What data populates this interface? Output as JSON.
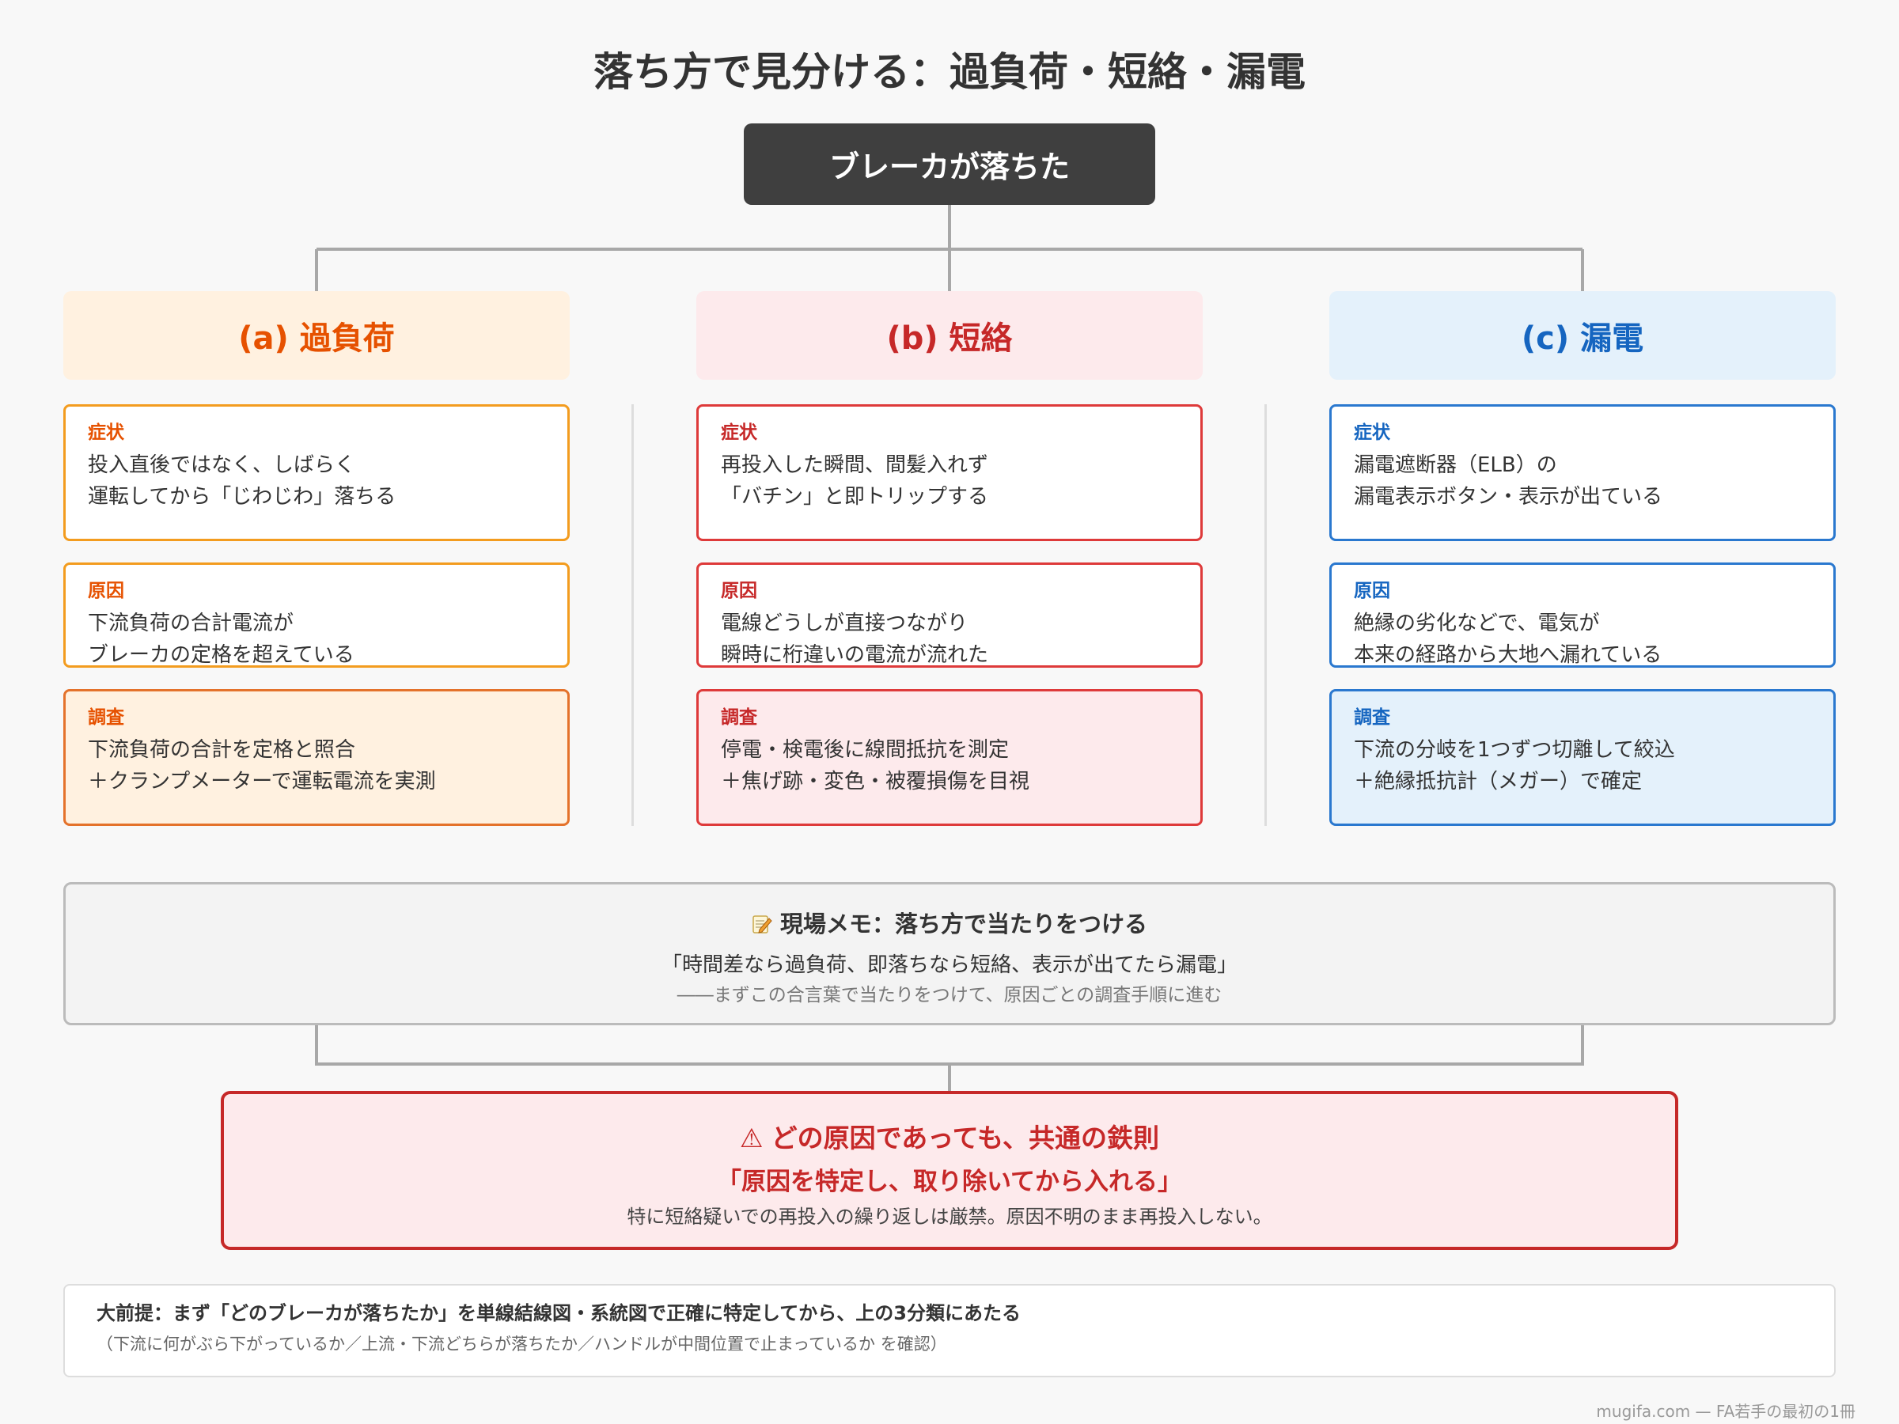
{
  "title": "落ち方で見分ける：過負荷・短絡・漏電",
  "root": "ブレーカが落ちた",
  "colors": {
    "overload": "#e65100",
    "overload_border": "#f39c1f",
    "overload_light": "#fff1e0",
    "overload_survey_border": "#e4722b",
    "short": "#c62828",
    "short_border": "#de3a3a",
    "short_light": "#fdeaec",
    "leak": "#1565c0",
    "leak_border": "#2a78cf",
    "leak_light": "#e4f1fb"
  },
  "columns": [
    {
      "header": "(a) 過負荷",
      "cards": [
        {
          "label": "症状",
          "text": "投入直後ではなく、しばらく\n運転してから「じわじわ」落ちる"
        },
        {
          "label": "原因",
          "text": "下流負荷の合計電流が\nブレーカの定格を超えている"
        },
        {
          "label": "調査",
          "text": "下流負荷の合計を定格と照合\n＋クランプメーターで運転電流を実測"
        }
      ]
    },
    {
      "header": "(b) 短絡",
      "cards": [
        {
          "label": "症状",
          "text": "再投入した瞬間、間髪入れず\n「バチン」と即トリップする"
        },
        {
          "label": "原因",
          "text": "電線どうしが直接つながり\n瞬時に桁違いの電流が流れた"
        },
        {
          "label": "調査",
          "text": "停電・検電後に線間抵抗を測定\n＋焦げ跡・変色・被覆損傷を目視"
        }
      ]
    },
    {
      "header": "(c) 漏電",
      "cards": [
        {
          "label": "症状",
          "text": "漏電遮断器（ELB）の\n漏電表示ボタン・表示が出ている"
        },
        {
          "label": "原因",
          "text": "絶縁の劣化などで、電気が\n本来の経路から大地へ漏れている"
        },
        {
          "label": "調査",
          "text": "下流の分岐を1つずつ切離して絞込\n＋絶縁抵抗計（メガー）で確定"
        }
      ]
    }
  ],
  "memo": {
    "icon": "memo-icon",
    "title": "現場メモ：落ち方で当たりをつける",
    "quote": "「時間差なら過負荷、即落ちなら短絡、表示が出てたら漏電」",
    "sub": "――まずこの合言葉で当たりをつけて、原因ごとの調査手順に進む"
  },
  "rule": {
    "icon": "warning-icon",
    "title": "どの原因であっても、共通の鉄則",
    "quote": "「原因を特定し、取り除いてから入れる」",
    "text": "特に短絡疑いでの再投入の繰り返しは厳禁。原因不明のまま再投入しない。"
  },
  "premise": {
    "main": "大前提：まず「どのブレーカが落ちたか」を単線結線図・系統図で正確に特定してから、上の3分類にあたる",
    "sub": "（下流に何がぶら下がっているか／上流・下流どちらが落ちたか／ハンドルが中間位置で止まっているか を確認）"
  },
  "credit": "mugifa.com — FA若手の最初の1冊"
}
